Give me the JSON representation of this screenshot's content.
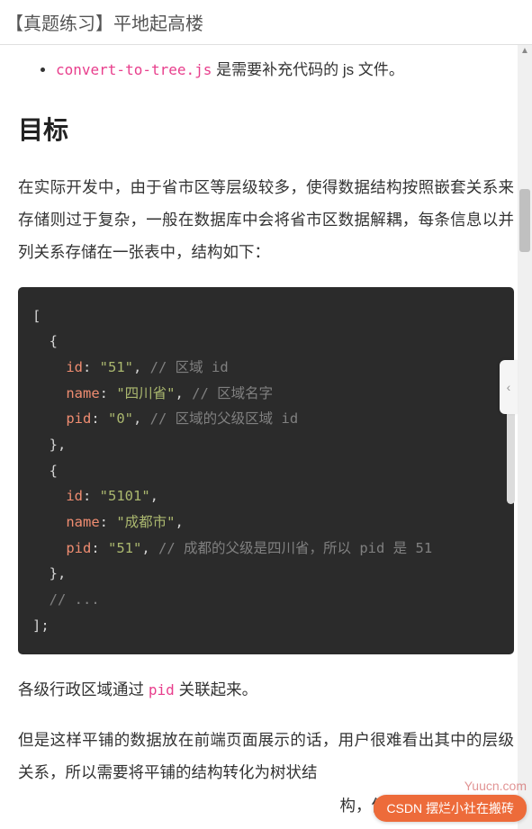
{
  "header": {
    "title": "【真题练习】平地起高楼"
  },
  "bullet": {
    "filename": "convert-to-tree.js",
    "suffix": " 是需要补充代码的 js 文件。"
  },
  "heading": "目标",
  "para1": "在实际开发中，由于省市区等层级较多，使得数据结构按照嵌套关系来存储则过于复杂，一般在数据库中会将省市区数据解耦，每条信息以并列关系存储在一张表中，结构如下：",
  "code": {
    "open_bracket": "[",
    "line1_open": "  {",
    "line2_key": "    id",
    "line2_colon": ": ",
    "line2_val": "\"51\"",
    "line2_comma": ",",
    "line2_com": " // 区域 id",
    "line3_key": "    name",
    "line3_colon": ": ",
    "line3_val": "\"四川省\"",
    "line3_comma": ",",
    "line3_com": " // 区域名字",
    "line4_key": "    pid",
    "line4_colon": ": ",
    "line4_val": "\"0\"",
    "line4_comma": ",",
    "line4_com": " // 区域的父级区域 id",
    "line5_close": "  },",
    "line6_open": "  {",
    "line7_key": "    id",
    "line7_colon": ": ",
    "line7_val": "\"5101\"",
    "line7_comma": ",",
    "line8_key": "    name",
    "line8_colon": ": ",
    "line8_val": "\"成都市\"",
    "line8_comma": ",",
    "line9_key": "    pid",
    "line9_colon": ": ",
    "line9_val": "\"51\"",
    "line9_comma": ",",
    "line9_com": " // 成都的父级是四川省，所以 pid 是 51",
    "line10_close": "  },",
    "line11_com": "  // ...",
    "close_bracket": "];"
  },
  "para2_prefix": "各级行政区域通过 ",
  "para2_code": "pid",
  "para2_suffix": " 关联起来。",
  "para3": "但是这样平铺的数据放在前端页面展示的话，用户很难看出其中的层级关系，所以需要将平铺的结构转化为树状结",
  "watermark": "Yuucn.com",
  "badge": "CSDN 摆烂小社在搬砖",
  "overlay_text": "构，便于前端展示。"
}
